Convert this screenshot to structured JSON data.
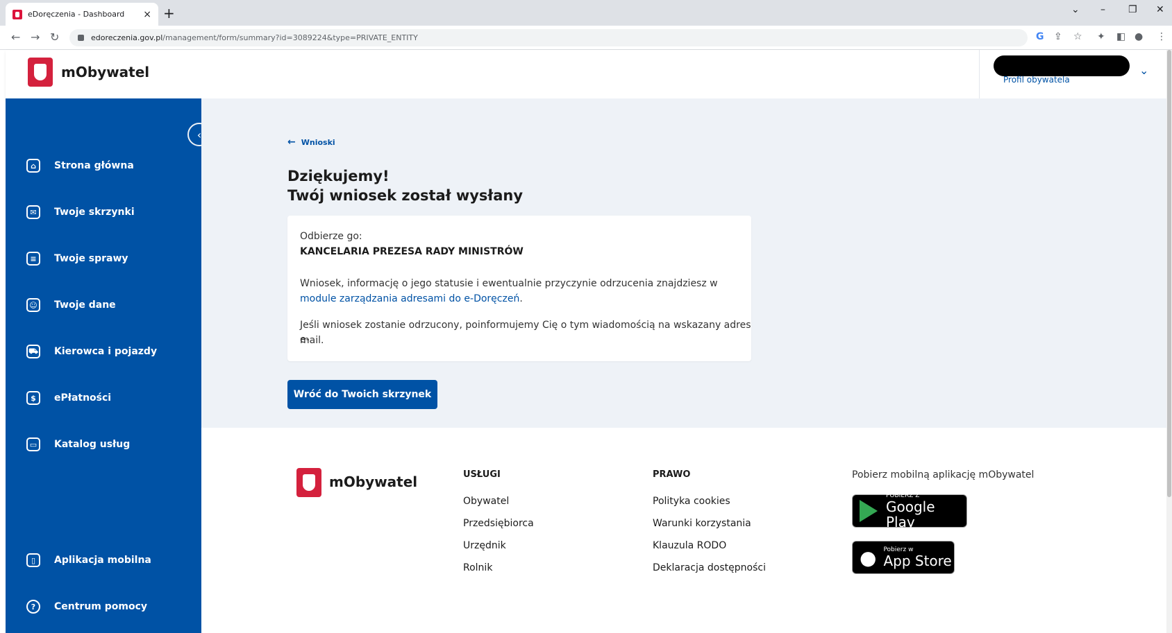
{
  "browser": {
    "tab_title": "eDoręczenia - Dashboard",
    "tab_close": "×",
    "new_tab": "+",
    "url_host": "edoreczenia.gov.pl",
    "url_path": "/management/form/summary?id=3089224&type=PRIVATE_ENTITY",
    "window_controls": [
      "⌄",
      "–",
      "❐",
      "✕"
    ]
  },
  "header": {
    "brand": "mObywatel",
    "profile_label": "Profil obywatela"
  },
  "sidebar": {
    "items": [
      {
        "label": "Strona główna",
        "icon": "home-icon",
        "glyph": "⌂"
      },
      {
        "label": "Twoje skrzynki",
        "icon": "mail-icon",
        "glyph": "✉"
      },
      {
        "label": "Twoje sprawy",
        "icon": "document-icon",
        "glyph": "≡"
      },
      {
        "label": "Twoje dane",
        "icon": "user-icon",
        "glyph": "☺"
      },
      {
        "label": "Kierowca i pojazdy",
        "icon": "car-icon",
        "glyph": "⛟"
      },
      {
        "label": "ePłatności",
        "icon": "wallet-icon",
        "glyph": "$"
      },
      {
        "label": "Katalog usług",
        "icon": "folder-icon",
        "glyph": "▭"
      }
    ],
    "bottom_items": [
      {
        "label": "Aplikacja mobilna",
        "icon": "phone-icon",
        "glyph": "▯"
      },
      {
        "label": "Centrum pomocy",
        "icon": "help-icon",
        "glyph": "?"
      }
    ]
  },
  "main": {
    "back_label": "Wnioski",
    "heading_line1": "Dziękujemy!",
    "heading_line2": "Twój wniosek został wysłany",
    "card": {
      "recipient_label": "Odbierze go:",
      "recipient": "KANCELARIA PREZESA RADY MINISTRÓW",
      "info_text": "Wniosek, informację o jego statusie i ewentualnie przyczynie odrzucenia znajdziesz w",
      "info_link": "module zarządzania adresami do e-Doręczeń",
      "info_end": ".",
      "reject_line1": "Jeśli wniosek zostanie odrzucony, poinformujemy Cię o tym wiadomością na wskazany adres e-",
      "reject_line2": "mail."
    },
    "primary_button": "Wróć do Twoich skrzynek"
  },
  "footer": {
    "brand": "mObywatel",
    "services_title": "USŁUGI",
    "services": [
      "Obywatel",
      "Przedsiębiorca",
      "Urzędnik",
      "Rolnik"
    ],
    "law_title": "PRAWO",
    "law": [
      "Polityka cookies",
      "Warunki korzystania",
      "Klauzula RODO",
      "Deklaracja dostępności"
    ],
    "app_text": "Pobierz mobilną aplikację mObywatel",
    "google_small": "POBIERZ Z",
    "google_big": "Google Play",
    "apple_small": "Pobierz w",
    "apple_big": "App Store"
  }
}
